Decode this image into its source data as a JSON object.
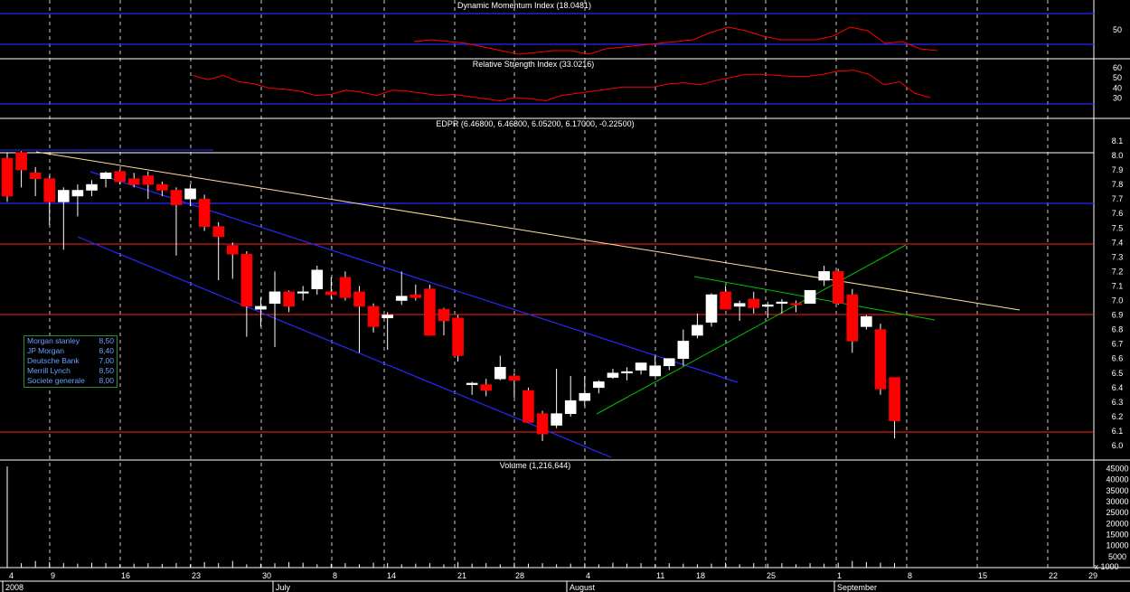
{
  "panels": {
    "dmi": {
      "title": "Dynamic Momentum Index (18.0481)",
      "ticks": [
        "50"
      ]
    },
    "rsi": {
      "title": "Relative Strength Index (33.0216)",
      "ticks": [
        "60",
        "50",
        "40",
        "30"
      ]
    },
    "price": {
      "title": "EDPR (6.46800, 6.46800, 6.05200, 6.17000, -0.22500)",
      "ticks": [
        "8.1",
        "8.0",
        "7.9",
        "7.8",
        "7.7",
        "7.6",
        "7.5",
        "7.4",
        "7.3",
        "7.2",
        "7.1",
        "7.0",
        "6.9",
        "6.8",
        "6.7",
        "6.6",
        "6.5",
        "6.4",
        "6.3",
        "6.2",
        "6.1",
        "6.0"
      ]
    },
    "volume": {
      "title": "Volume (1,216,644)",
      "ticks": [
        "45000",
        "40000",
        "35000",
        "30000",
        "25000",
        "20000",
        "15000",
        "10000",
        "5000"
      ],
      "multiplier": "x 1000"
    }
  },
  "x_axis": {
    "day_labels": [
      "4",
      "9",
      "16",
      "23",
      "30",
      "8",
      "14",
      "21",
      "28",
      "4",
      "11",
      "18",
      "25",
      "1",
      "8",
      "15",
      "22",
      "29"
    ],
    "month_labels": [
      "2008",
      "July",
      "August",
      "September"
    ]
  },
  "legend": {
    "items": [
      {
        "name": "Morgan stanley",
        "value": "8,50"
      },
      {
        "name": "JP Morgan",
        "value": "8,40"
      },
      {
        "name": "Deutsche Bank",
        "value": "7,00"
      },
      {
        "name": "Merrill Lynch",
        "value": "8,50"
      },
      {
        "name": "Societe generale",
        "value": "8,00"
      }
    ]
  },
  "colors": {
    "up": "#ffffff",
    "down": "#ff0000",
    "grid": "#c8c8c8",
    "separator": "#ffffff",
    "channel": "#2828ff",
    "support": "#ff2020",
    "trend_down": "#ffe0a0",
    "trend_up": "#00c000"
  },
  "chart_data": {
    "type": "candlestick",
    "series": [
      {
        "name": "EDPR",
        "candles": [
          [
            7.98,
            8.02,
            7.68,
            7.72
          ],
          [
            8.02,
            8.03,
            7.78,
            7.9
          ],
          [
            7.88,
            7.92,
            7.72,
            7.84
          ],
          [
            7.84,
            7.86,
            7.52,
            7.68
          ],
          [
            7.68,
            7.78,
            7.35,
            7.76
          ],
          [
            7.72,
            7.8,
            7.58,
            7.76
          ],
          [
            7.76,
            7.83,
            7.72,
            7.8
          ],
          [
            7.84,
            7.89,
            7.78,
            7.88
          ],
          [
            7.89,
            7.9,
            7.8,
            7.82
          ],
          [
            7.84,
            7.88,
            7.78,
            7.8
          ],
          [
            7.86,
            7.89,
            7.7,
            7.8
          ],
          [
            7.8,
            7.82,
            7.72,
            7.76
          ],
          [
            7.76,
            7.78,
            7.31,
            7.66
          ],
          [
            7.7,
            7.8,
            7.65,
            7.77
          ],
          [
            7.7,
            7.73,
            7.48,
            7.51
          ],
          [
            7.51,
            7.54,
            7.14,
            7.44
          ],
          [
            7.38,
            7.4,
            7.15,
            7.32
          ],
          [
            7.32,
            7.34,
            6.75,
            6.96
          ],
          [
            6.94,
            7.02,
            6.82,
            6.96
          ],
          [
            6.98,
            7.2,
            6.68,
            7.06
          ],
          [
            7.06,
            7.07,
            6.92,
            6.96
          ],
          [
            7.06,
            7.1,
            7.0,
            7.06
          ],
          [
            7.08,
            7.24,
            7.04,
            7.21
          ],
          [
            7.06,
            7.16,
            7.01,
            7.04
          ],
          [
            7.16,
            7.2,
            7.0,
            7.02
          ],
          [
            7.06,
            7.1,
            6.64,
            6.96
          ],
          [
            6.96,
            6.98,
            6.78,
            6.82
          ],
          [
            6.88,
            6.92,
            6.66,
            6.9
          ],
          [
            7.0,
            7.2,
            6.97,
            7.03
          ],
          [
            7.04,
            7.11,
            7.0,
            7.02
          ],
          [
            7.08,
            7.11,
            6.8,
            6.76
          ],
          [
            6.94,
            6.95,
            6.76,
            6.86
          ],
          [
            6.88,
            6.9,
            6.58,
            6.62
          ],
          [
            6.42,
            6.44,
            6.35,
            6.43
          ],
          [
            6.42,
            6.46,
            6.34,
            6.38
          ],
          [
            6.46,
            6.62,
            6.45,
            6.54
          ],
          [
            6.48,
            6.5,
            6.33,
            6.45
          ],
          [
            6.38,
            6.4,
            6.18,
            6.16
          ],
          [
            6.22,
            6.24,
            6.03,
            6.08
          ],
          [
            6.14,
            6.53,
            6.12,
            6.22
          ],
          [
            6.22,
            6.48,
            6.2,
            6.31
          ],
          [
            6.31,
            6.48,
            6.27,
            6.36
          ],
          [
            6.4,
            6.45,
            6.36,
            6.44
          ],
          [
            6.47,
            6.53,
            6.46,
            6.5
          ],
          [
            6.5,
            6.54,
            6.45,
            6.51
          ],
          [
            6.52,
            6.57,
            6.49,
            6.57
          ],
          [
            6.48,
            6.62,
            6.48,
            6.55
          ],
          [
            6.55,
            6.6,
            6.52,
            6.6
          ],
          [
            6.6,
            6.8,
            6.55,
            6.72
          ],
          [
            6.76,
            6.91,
            6.74,
            6.83
          ],
          [
            6.85,
            7.05,
            6.82,
            7.04
          ],
          [
            7.06,
            7.1,
            6.95,
            6.94
          ],
          [
            6.96,
            7.0,
            6.86,
            6.98
          ],
          [
            7.01,
            7.06,
            6.91,
            6.95
          ],
          [
            6.96,
            6.99,
            6.88,
            6.97
          ],
          [
            6.98,
            7.01,
            6.91,
            6.99
          ],
          [
            6.98,
            7.0,
            6.92,
            6.97
          ],
          [
            6.98,
            7.07,
            6.98,
            7.07
          ],
          [
            7.14,
            7.24,
            7.1,
            7.2
          ],
          [
            7.2,
            7.22,
            6.97,
            6.98
          ],
          [
            7.04,
            7.08,
            6.64,
            6.72
          ],
          [
            6.82,
            6.9,
            6.8,
            6.89
          ],
          [
            6.8,
            6.84,
            6.35,
            6.39
          ],
          [
            6.47,
            6.47,
            6.05,
            6.17
          ]
        ]
      }
    ],
    "dmi_values": [
      47,
      48,
      47,
      46,
      44,
      42,
      40,
      41,
      42,
      42,
      40,
      43,
      44,
      45,
      46,
      47,
      48,
      52,
      55,
      53,
      50,
      48,
      48,
      48,
      50,
      55,
      53,
      46,
      47,
      43,
      42
    ],
    "rsi_values": [
      57,
      53,
      57,
      51,
      49,
      45,
      44,
      42,
      38,
      39,
      43,
      41,
      38,
      43,
      42,
      40,
      38,
      39,
      37,
      35,
      33,
      36,
      35,
      33,
      38,
      40,
      42,
      44,
      46,
      46,
      46,
      49,
      50,
      48,
      52,
      55,
      58,
      58,
      57,
      56,
      56,
      58,
      61,
      62,
      58,
      48,
      51,
      40,
      36
    ],
    "volume_values": [
      46000,
      2000,
      3000,
      2500,
      2000,
      1800,
      2200,
      2000,
      1500,
      1800,
      2000,
      1700,
      2000,
      1500,
      2500,
      2000,
      3000,
      1500,
      1800,
      2000,
      2500,
      2200,
      1500,
      1800,
      2000,
      1500,
      2200,
      2000,
      1500,
      1800,
      2000,
      1500,
      2500,
      1800,
      2000,
      1500,
      2200,
      1800,
      2000,
      1500,
      1800,
      2000,
      1500,
      2200,
      1800,
      2000,
      1500,
      2000,
      1800,
      1500,
      1800,
      2200,
      1500,
      2000,
      1800,
      2000,
      1500,
      2000,
      1800,
      2200,
      3000,
      2500,
      2200,
      2000
    ],
    "price_ylim": [
      6.0,
      8.1
    ],
    "annotations": [
      "down-trend line",
      "down channel",
      "up-trend line",
      "support lines"
    ]
  }
}
